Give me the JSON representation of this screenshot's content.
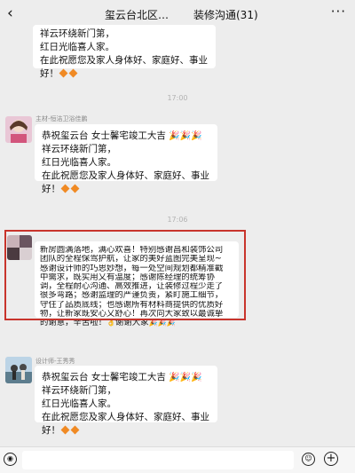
{
  "header": {
    "back": "‹",
    "title_left": "玺云台北区…",
    "title_right": "装修沟通(31)",
    "more": "···"
  },
  "messages": {
    "m1": {
      "lines": [
        "祥云环绕新门第，",
        "红日光临喜人家。",
        "在此祝愿您及家人身体好、家庭好、事业好！"
      ]
    },
    "ts1": "17:00",
    "m2": {
      "sender": "主材-恒洁卫浴佳鹏",
      "first": "恭祝玺云台    女士馨宅竣工大吉",
      "lines": [
        "祥云环绕新门第，",
        "红日光临喜人家。",
        "在此祝愿您及家人身体好、家庭好、事业好！"
      ]
    },
    "ts2": "17:06",
    "m3": {
      "lines": [
        "新房圆满落地，满心欢喜！特别感谢昌和装饰公司",
        "团队的全程保驾护航，让家的美好蓝图完美呈现~",
        "感谢设计师的巧思妙想，每一处空间规划都精准戳",
        "中需求，既实用又有温度；感谢陈经理的统筹协",
        "调，全程耐心沟通、高效推进，让装修过程少走了",
        "很多弯路；感谢监理的严谨负责，紧盯施工细节，",
        "守住了品质底线；也感谢所有材料商提供的优质好",
        "物，让新家既安心又舒心！再次向大家致以最诚挚",
        "的谢意，辛苦啦！",
        "谢谢大家"
      ]
    },
    "m4": {
      "sender": "设计师-王秀秀",
      "first": "恭祝玺云台    女士馨宅竣工大吉",
      "lines": [
        "祥云环绕新门第，",
        "红日光临喜人家。",
        "在此祝愿您及家人身体好、家庭好、事业好！"
      ]
    }
  },
  "icons": {
    "firework": "🎉",
    "ok_hand": "👌",
    "voice": "◉",
    "emoji": "☺",
    "plus": "+"
  },
  "colors": {
    "background": "#ededed",
    "bubble": "#ffffff",
    "highlight_box": "#c8342c",
    "diamond": "#f08a24"
  }
}
